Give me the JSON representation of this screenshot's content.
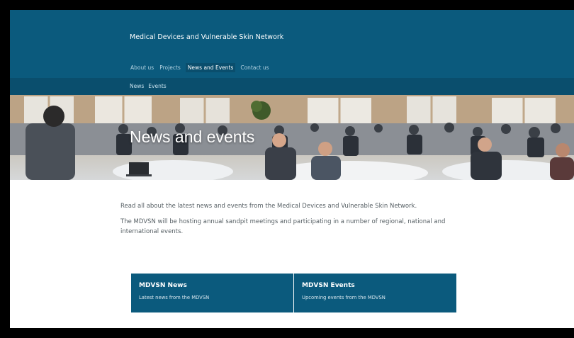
{
  "header": {
    "site_title": "Medical Devices and Vulnerable Skin Network",
    "nav": [
      {
        "label": "About us"
      },
      {
        "label": "Projects"
      },
      {
        "label": "News and Events",
        "active": true
      },
      {
        "label": "Contact us"
      }
    ],
    "subnav": [
      {
        "label": "News"
      },
      {
        "label": "Events"
      }
    ]
  },
  "hero": {
    "title": "News and events"
  },
  "intro": {
    "p1": "Read all about the latest news and events from the Medical Devices and Vulnerable Skin Network.",
    "p2": "The MDVSN will be hosting annual sandpit meetings and participating in a number of regional, national and international events."
  },
  "cards": [
    {
      "title": "MDVSN News",
      "desc": "Latest news from the MDVSN"
    },
    {
      "title": "MDVSN Events",
      "desc": "Upcoming events from the MDVSN"
    }
  ],
  "colors": {
    "header_bg": "#0b5a7d",
    "subnav_bg": "#0a4e6d",
    "card_bg": "#0b5a7d",
    "page_bg": "#ffffff"
  }
}
